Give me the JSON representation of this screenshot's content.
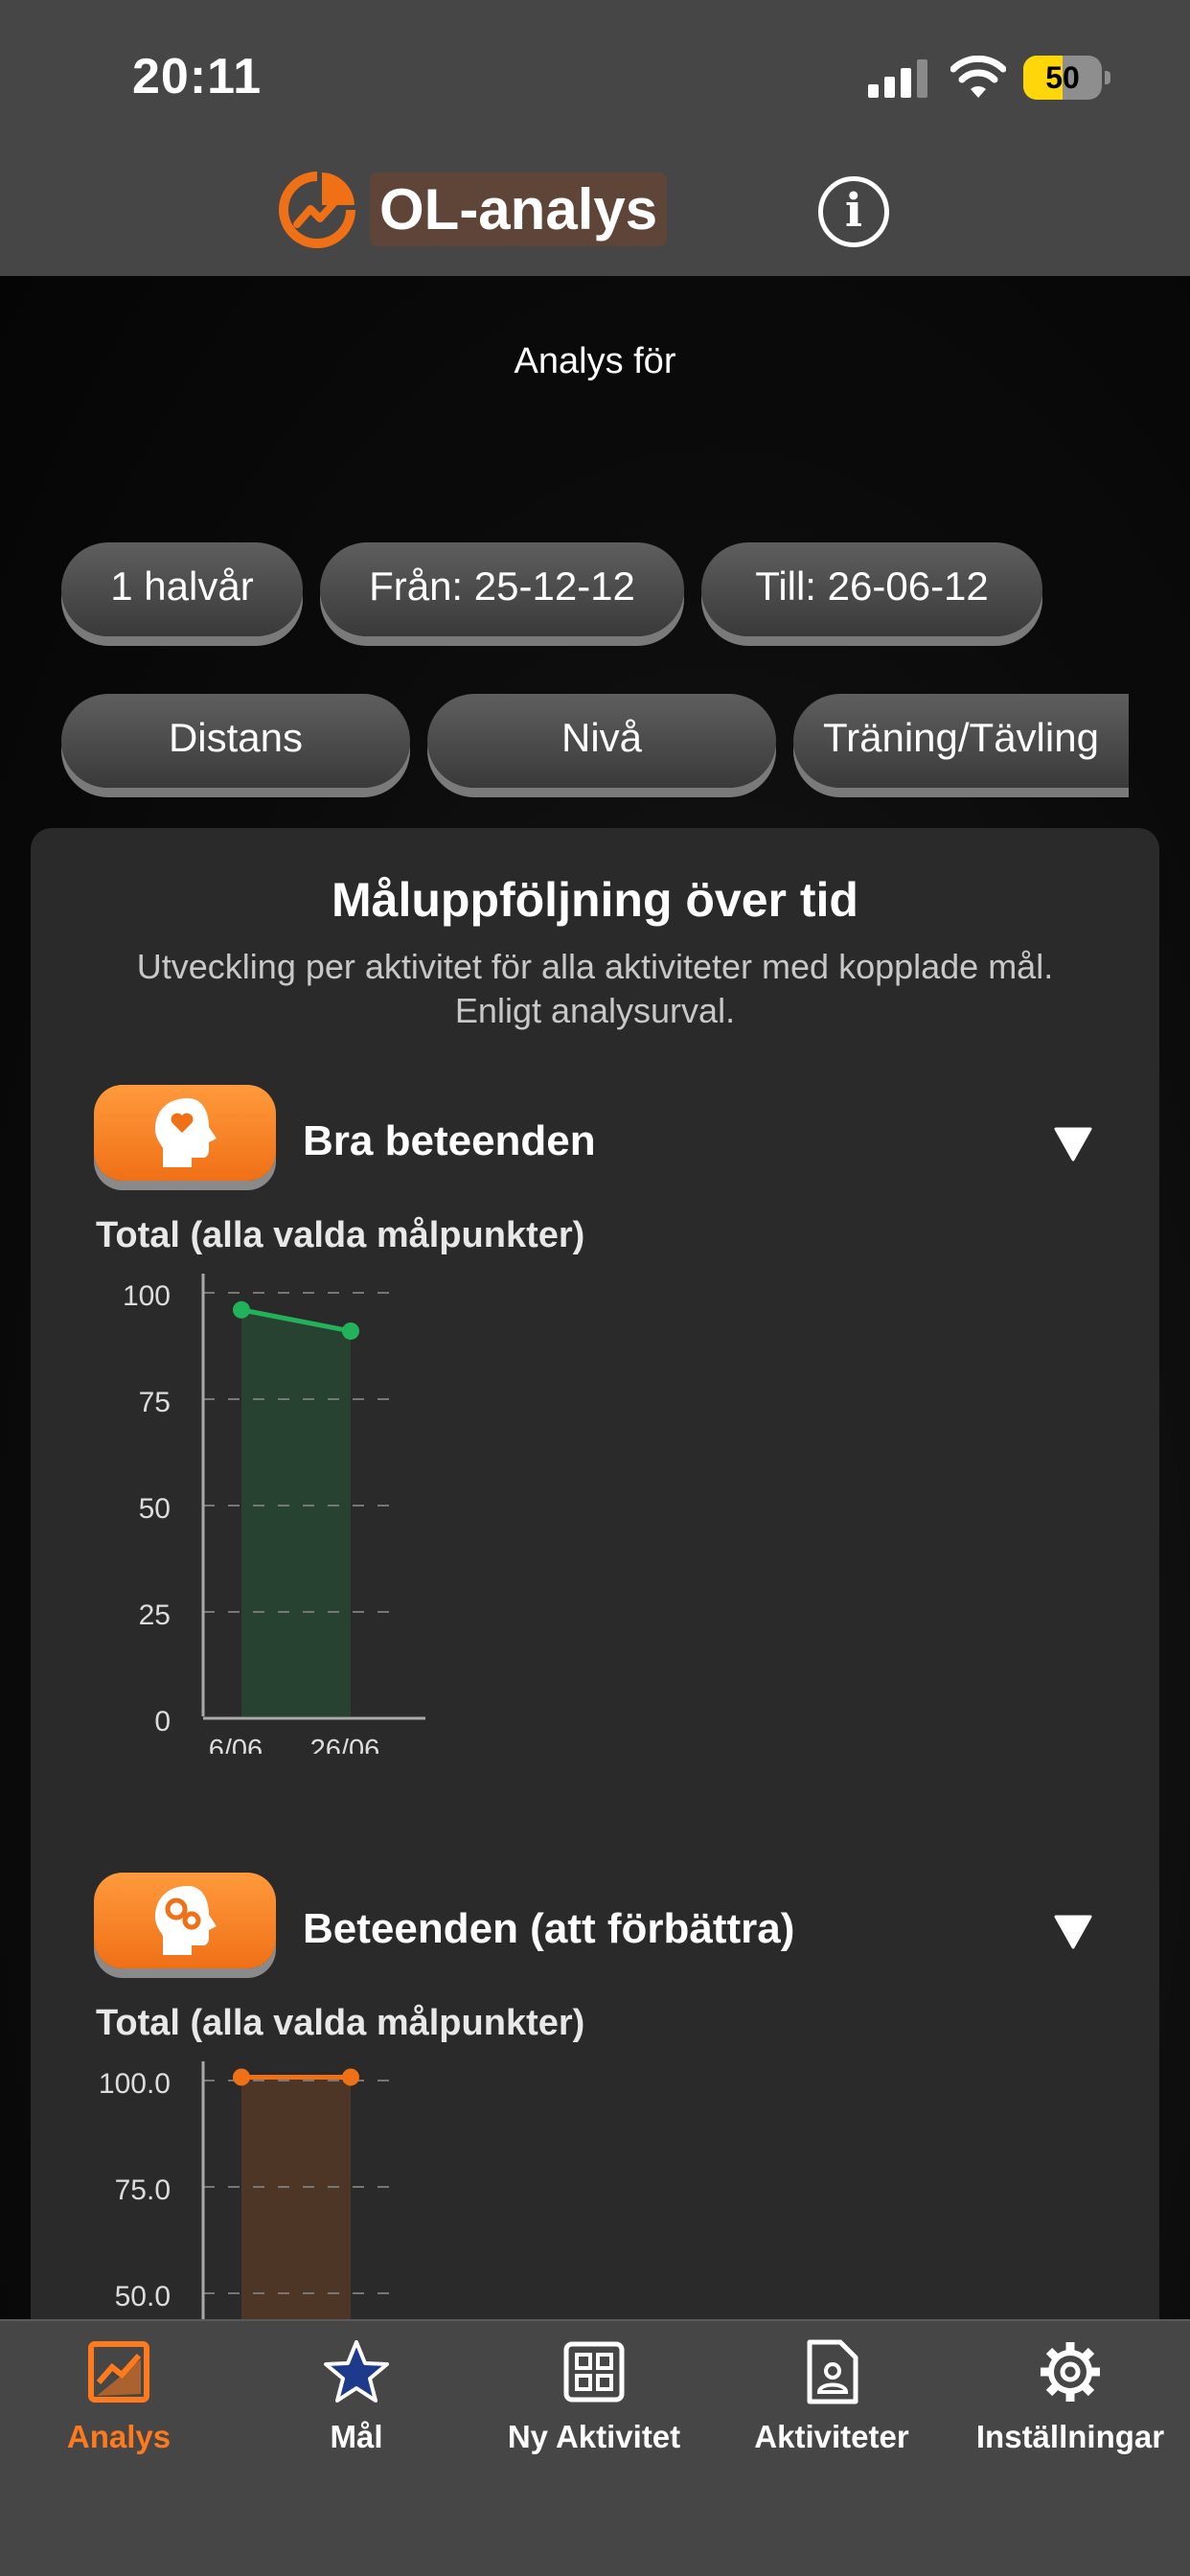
{
  "status": {
    "time": "20:11",
    "battery": "50",
    "battery_level": 0.5
  },
  "header": {
    "title": "OL-analys",
    "info_icon": "info-icon",
    "logo_icon": "analysis-logo-icon"
  },
  "filters": {
    "analys_label": "Analys för",
    "period": "1 halvår",
    "from": "Från: 25-12-12",
    "to": "Till: 26-06-12",
    "distance": "Distans",
    "level": "Nivå",
    "type": "Träning/Tävling"
  },
  "card": {
    "title": "Måluppföljning över tid",
    "subtitle": "Utveckling per aktivitet för alla aktiviteter med kopplade mål. Enligt analysurval."
  },
  "goals": [
    {
      "title": "Bra beteenden",
      "icon": "head-heart-icon",
      "chart_label": "Total (alla valda målpunkter)"
    },
    {
      "title": "Beteenden (att förbättra)",
      "icon": "head-gears-icon",
      "chart_label": "Total (alla valda målpunkter)"
    }
  ],
  "chart_data": [
    {
      "type": "line",
      "title": "Total (alla valda målpunkter)",
      "categories": [
        "6/06...",
        "26/06..."
      ],
      "series": [
        {
          "values": [
            96,
            91
          ],
          "color": "#22b35a"
        }
      ],
      "yticks": [
        "100",
        "75",
        "50",
        "25",
        "0"
      ],
      "ylim": [
        0,
        100
      ],
      "grid": true
    },
    {
      "type": "line",
      "title": "Total (alla valda målpunkter)",
      "categories": [],
      "series": [
        {
          "values": [
            100.8,
            100.8
          ],
          "color": "#f07016"
        }
      ],
      "yticks": [
        "100.0",
        "75.0",
        "50.0"
      ],
      "ylim": [
        0,
        100
      ],
      "grid": true
    }
  ],
  "tabs": [
    {
      "label": "Analys",
      "icon": "chart-icon",
      "active": true
    },
    {
      "label": "Mål",
      "icon": "star-icon",
      "active": false
    },
    {
      "label": "Ny Aktivitet",
      "icon": "grid-icon",
      "active": false
    },
    {
      "label": "Aktiviteter",
      "icon": "document-person-icon",
      "active": false
    },
    {
      "label": "Inställningar",
      "icon": "gear-icon",
      "active": false
    }
  ],
  "colors": {
    "accent": "#ff7a1c",
    "bar": "#464646",
    "card": "#2a2a2a"
  }
}
